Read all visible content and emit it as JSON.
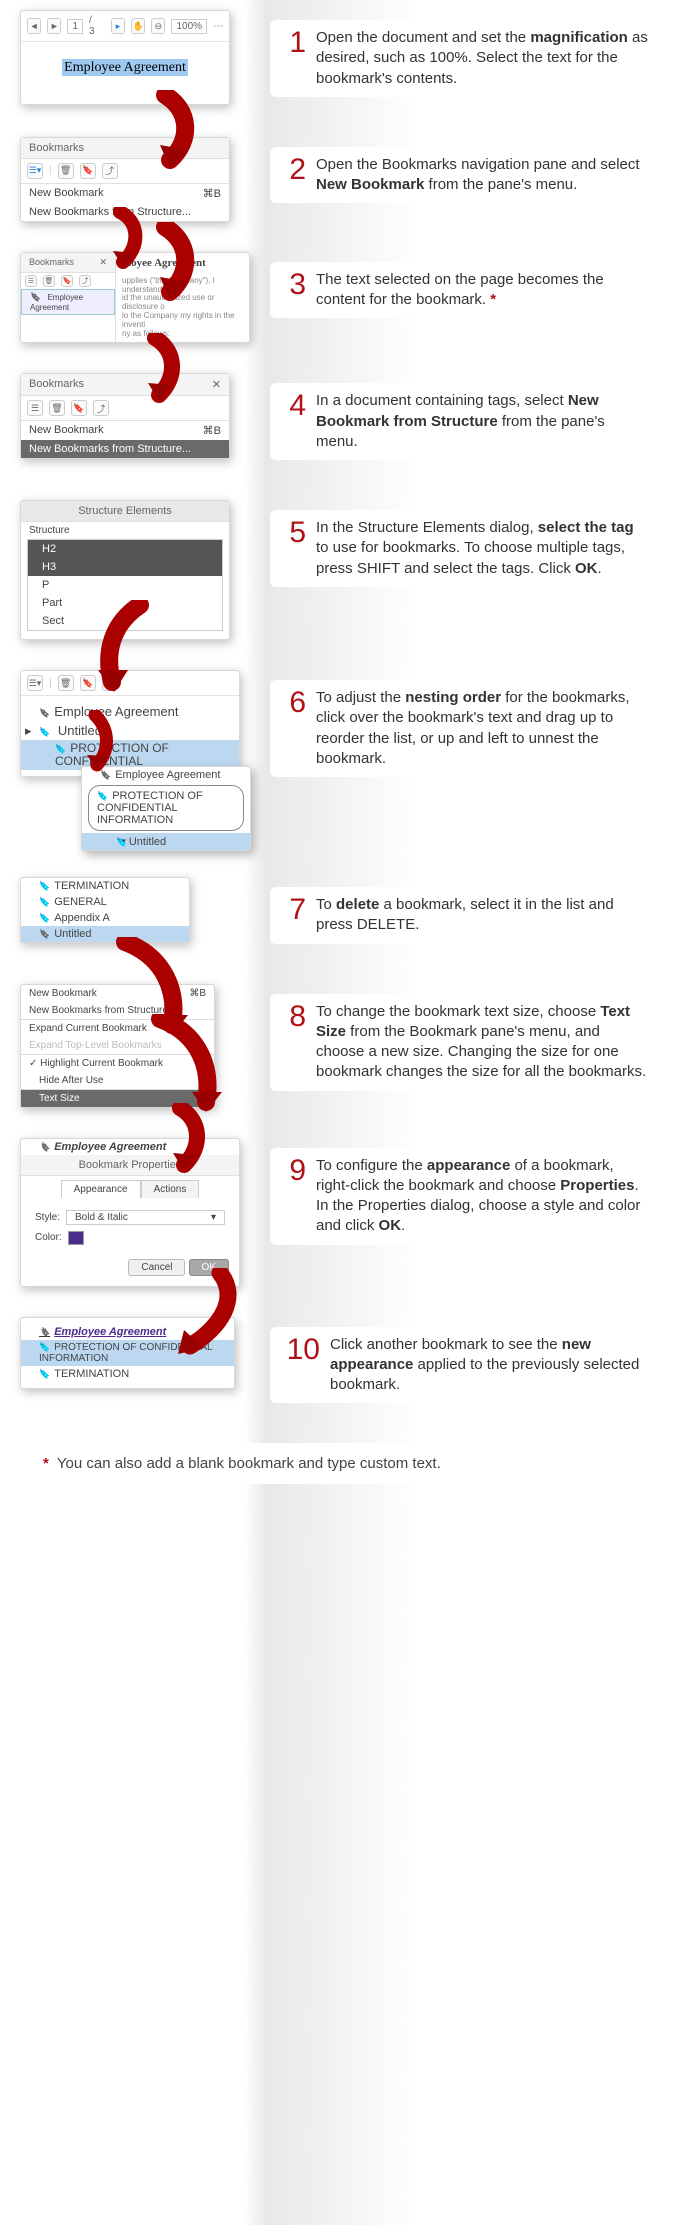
{
  "steps": [
    {
      "n": "1",
      "parts": [
        "Open the document and set the ",
        {
          "b": "magnification"
        },
        " as desired, such as 100%. Select the text for the bookmark's contents."
      ]
    },
    {
      "n": "2",
      "parts": [
        "Open the Bookmarks navigation pane and select ",
        {
          "b": "New Bookmark"
        },
        " from the pane's menu."
      ]
    },
    {
      "n": "3",
      "parts": [
        "The text selected on the page becomes the content for the bookmark. ",
        {
          "ast": "*"
        }
      ]
    },
    {
      "n": "4",
      "parts": [
        "In a document containing tags, select ",
        {
          "b": "New Bookmark from Structure"
        },
        " from the pane's menu."
      ]
    },
    {
      "n": "5",
      "parts": [
        "In the Structure Elements dialog, ",
        {
          "b": "select the tag"
        },
        " to use for bookmarks. To choose multiple tags, press SHIFT and select the tags. Click ",
        {
          "b": "OK"
        },
        "."
      ]
    },
    {
      "n": "6",
      "parts": [
        "To adjust the ",
        {
          "b": "nesting order"
        },
        " for the bookmarks, click over the bookmark's text and drag up to reorder the list, or up and left to unnest the bookmark."
      ]
    },
    {
      "n": "7",
      "parts": [
        "To ",
        {
          "b": "delete"
        },
        " a bookmark, select it in the list and press DELETE."
      ]
    },
    {
      "n": "8",
      "parts": [
        "To change the bookmark text size, choose ",
        {
          "b": "Text Size"
        },
        " from the Bookmark pane's menu, and choose a new size. Changing the size for one bookmark changes the size for all the bookmarks."
      ]
    },
    {
      "n": "9",
      "parts": [
        "To configure the ",
        {
          "b": "appearance"
        },
        " of a bookmark, right-click the bookmark and choose ",
        {
          "b": "Properties"
        },
        ". In the Properties dialog, choose a style and color and click ",
        {
          "b": "OK"
        },
        "."
      ]
    },
    {
      "n": "10",
      "parts": [
        "Click another bookmark to see the ",
        {
          "b": "new appearance"
        },
        " applied to the previously selected bookmark."
      ]
    }
  ],
  "footnote_mark": "*",
  "footnote_text": "You can also add a blank bookmark and type custom text.",
  "p1": {
    "page": "1",
    "pages": "/ 3",
    "zoom": "100%",
    "title": "Employee  Agreement"
  },
  "p2": {
    "title": "Bookmarks",
    "m1": "New Bookmark",
    "m1k": "⌘B",
    "m2": "New Bookmarks from Structure..."
  },
  "p3": {
    "title": "Bookmarks",
    "bm": "Employee Agreement",
    "doc_title": "ployee  Agreement",
    "body": "upplies (\"the Company\"), I understand\nid the unauthorized use or disclosure o\nlo the Company my rights in the inventi\nny as follows:"
  },
  "p4": {
    "title": "Bookmarks",
    "m1": "New Bookmark",
    "m1k": "⌘B",
    "m2": "New Bookmarks from Structure..."
  },
  "p5": {
    "title": "Structure Elements",
    "label": "Structure",
    "rows": [
      "H2",
      "H3",
      "P",
      "Part",
      "Sect"
    ]
  },
  "p6": {
    "bm1": "Employee Agreement",
    "bm2": "Untitled",
    "bm3": "PROTECTION OF CONFIDENTIAL",
    "drag1": "Employee Agreement",
    "drag2": "PROTECTION OF CONFIDENTIAL INFORMATION",
    "drag3": "Untitled"
  },
  "p7": {
    "rows": [
      "TERMINATION",
      "GENERAL",
      "Appendix A",
      "Untitled"
    ]
  },
  "p8": {
    "rows": [
      "New Bookmark",
      "New Bookmarks from Structure...",
      "Expand Current Bookmark",
      "Expand Top-Level Bookmarks",
      "Highlight Current Bookmark",
      "Hide After Use",
      "Text Size"
    ],
    "k1": "⌘B"
  },
  "p9": {
    "bm": "Employee Agreement",
    "title": "Bookmark Properties",
    "tab1": "Appearance",
    "tab2": "Actions",
    "style_lbl": "Style:",
    "style_val": "Bold & Italic",
    "color_lbl": "Color:",
    "cancel": "Cancel",
    "ok": "OK"
  },
  "p10": {
    "bm1": "Employee Agreement",
    "bm2": "PROTECTION OF CONFIDENTIAL INFORMATION",
    "bm3": "TERMINATION"
  }
}
